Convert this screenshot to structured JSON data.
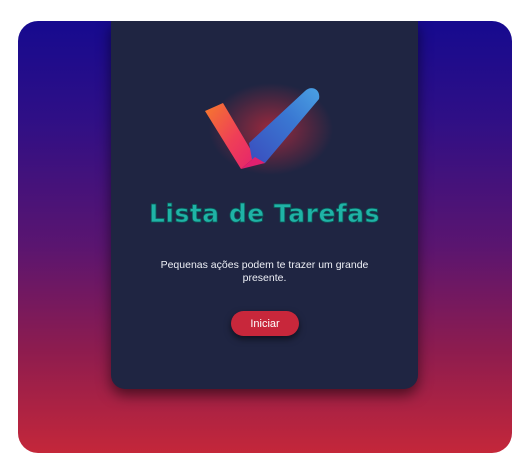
{
  "app": {
    "title": "Lista de Tarefas",
    "subtitle": "Pequenas ações podem te trazer um grande presente.",
    "start_button_label": "Iniciar"
  },
  "logo": {
    "icon": "checkmark-icon"
  },
  "colors": {
    "background_top": "#160a8f",
    "background_bottom": "#c4273a",
    "card": "#1f2542",
    "title": "#1fb3a6",
    "button": "#c8273b"
  }
}
